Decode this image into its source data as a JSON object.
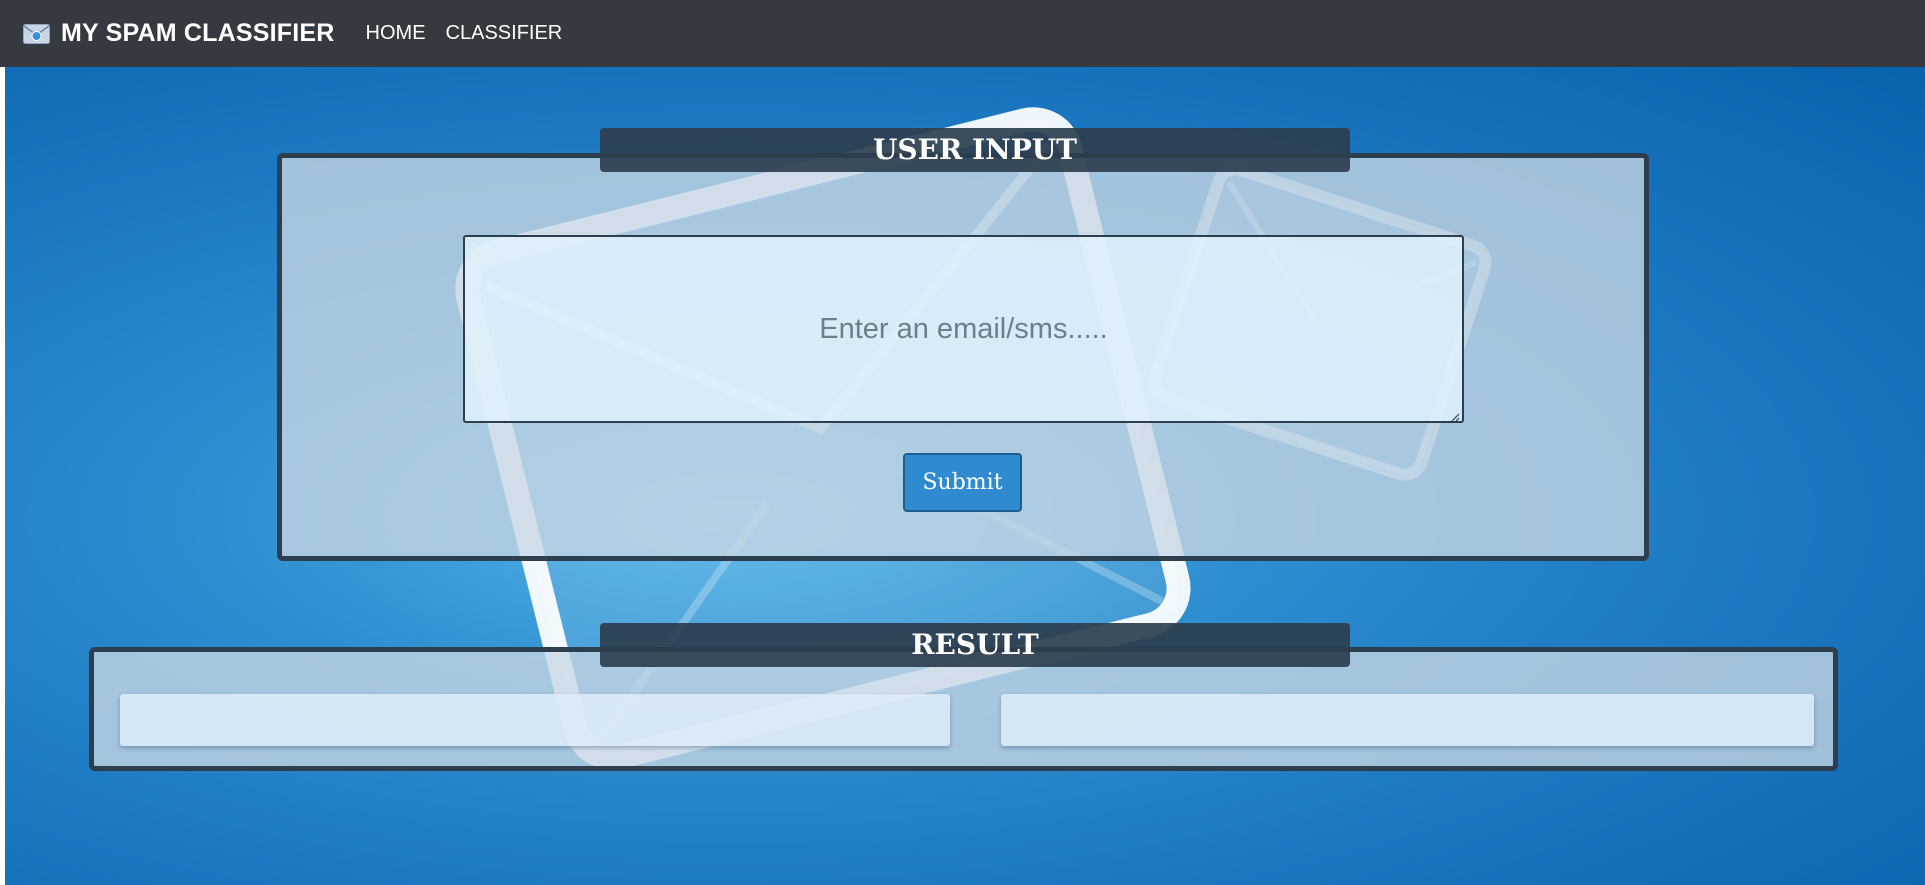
{
  "navbar": {
    "brand": "MY SPAM CLASSIFIER",
    "brand_icon": "envelope-icon",
    "links": [
      "HOME",
      "CLASSIFIER"
    ]
  },
  "input_panel": {
    "title": "USER INPUT",
    "textarea_placeholder": "Enter an email/sms.....",
    "textarea_value": "",
    "submit_label": "Submit"
  },
  "result_panel": {
    "title": "RESULT",
    "left_value": "",
    "right_value": ""
  },
  "colors": {
    "navbar": "#343a40",
    "panel_border": "#2d3e4e",
    "button": "#2f8ad0",
    "background": "#1c79c2"
  }
}
